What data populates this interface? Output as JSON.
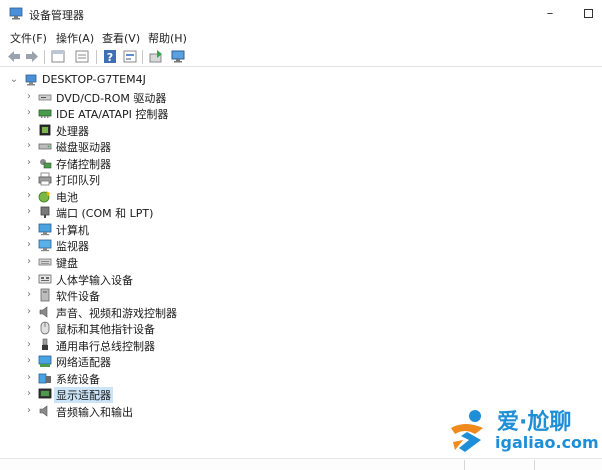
{
  "window": {
    "title": "设备管理器",
    "minimize_glyph": "–"
  },
  "menu": [
    "文件(F)",
    "操作(A)",
    "查看(V)",
    "帮助(H)"
  ],
  "tree": {
    "root": "DESKTOP-G7TEM4J",
    "selected_index": 18,
    "items": [
      {
        "label": "DVD/CD-ROM 驱动器",
        "icon": "dvd-drive-icon"
      },
      {
        "label": "IDE ATA/ATAPI 控制器",
        "icon": "ide-controller-icon"
      },
      {
        "label": "处理器",
        "icon": "processor-icon"
      },
      {
        "label": "磁盘驱动器",
        "icon": "disk-drive-icon"
      },
      {
        "label": "存储控制器",
        "icon": "storage-controller-icon"
      },
      {
        "label": "打印队列",
        "icon": "printer-icon"
      },
      {
        "label": "电池",
        "icon": "battery-icon"
      },
      {
        "label": "端口 (COM 和 LPT)",
        "icon": "port-icon"
      },
      {
        "label": "计算机",
        "icon": "computer-icon"
      },
      {
        "label": "监视器",
        "icon": "monitor-icon"
      },
      {
        "label": "键盘",
        "icon": "keyboard-icon"
      },
      {
        "label": "人体学输入设备",
        "icon": "hid-icon"
      },
      {
        "label": "软件设备",
        "icon": "software-device-icon"
      },
      {
        "label": "声音、视频和游戏控制器",
        "icon": "speaker-icon"
      },
      {
        "label": "鼠标和其他指针设备",
        "icon": "mouse-icon"
      },
      {
        "label": "通用串行总线控制器",
        "icon": "usb-icon"
      },
      {
        "label": "网络适配器",
        "icon": "network-adapter-icon"
      },
      {
        "label": "系统设备",
        "icon": "system-device-icon"
      },
      {
        "label": "显示适配器",
        "icon": "display-adapter-icon"
      },
      {
        "label": "音频输入和输出",
        "icon": "audio-io-icon"
      }
    ]
  },
  "watermark": {
    "brand": "爱·尬聊",
    "domain": "igaliao.com"
  },
  "colors": {
    "selection": "#cce4f7",
    "watermark_blue": "#1e8fd6",
    "watermark_orange": "#f08a1c"
  }
}
